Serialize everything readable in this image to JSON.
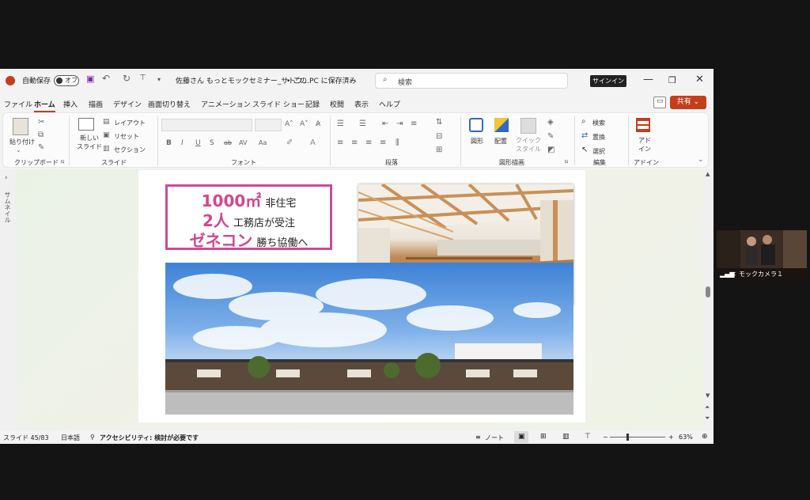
{
  "titlebar": {
    "autosave_label": "自動保存",
    "autosave_state": "オフ",
    "doc_title": "佐藤さん もっとモックセミナー_サトウ…",
    "save_location": "• この PC に保存済み",
    "search_placeholder": "検索",
    "signin_label": "サインイン"
  },
  "menu": {
    "tabs": [
      "ファイル",
      "ホーム",
      "挿入",
      "描画",
      "デザイン",
      "画面切り替え",
      "アニメーション",
      "スライド ショー",
      "記録",
      "校閲",
      "表示",
      "ヘルプ"
    ],
    "share_label": "共有"
  },
  "ribbon": {
    "clipboard": {
      "paste_label": "貼り付け",
      "group_label": "クリップボード"
    },
    "slides": {
      "new_slide_label": "新しい\nスライド",
      "layout_label": "レイアウト",
      "reset_label": "リセット",
      "section_label": "セクション",
      "group_label": "スライド"
    },
    "font": {
      "group_label": "フォント"
    },
    "paragraph": {
      "group_label": "段落"
    },
    "drawing": {
      "shape_label": "図形",
      "arrange_label": "配置",
      "quick_style_label": "クイック\nスタイル",
      "group_label": "図形描画"
    },
    "editing": {
      "find_label": "検索",
      "replace_label": "置換",
      "select_label": "選択",
      "group_label": "編集"
    },
    "addins": {
      "addin_label": "アド\nイン",
      "group_label": "アドイン"
    }
  },
  "sidebar": {
    "thumbnail_label": "サムネイル"
  },
  "slide": {
    "line1_big": "1000㎡",
    "line1_small": "非住宅",
    "line2_big": "2人",
    "line2_small": "工務店が受注",
    "line3_big": "ゼネコン",
    "line3_small": "勝ち協働へ"
  },
  "statusbar": {
    "slide_position": "スライド 45/83",
    "language": "日本語",
    "accessibility": "アクセシビリティ: 検討が必要です",
    "notes_label": "ノート",
    "zoom": "63%"
  },
  "camera": {
    "label": "モックカメラ１"
  },
  "colors": {
    "accent": "#c43e1c",
    "headline_pink": "#d2468f",
    "border_pink": "#cf4a9c"
  }
}
